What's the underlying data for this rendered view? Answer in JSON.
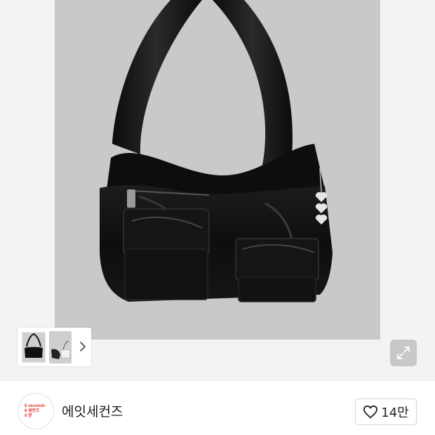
{
  "brand": {
    "name": "에잇세컨즈",
    "logo_text": "8 seconds\n8 세컨즈\n8 한"
  },
  "like": {
    "icon": "heart-outline-icon",
    "count": "14만"
  },
  "gallery": {
    "next_icon": "chevron-right-icon",
    "expand_icon": "expand-arrows-icon"
  },
  "colors": {
    "accent": "#e33b2f",
    "photo_bg": "#c9c9cb",
    "page_bg": "#f3f3f4"
  }
}
